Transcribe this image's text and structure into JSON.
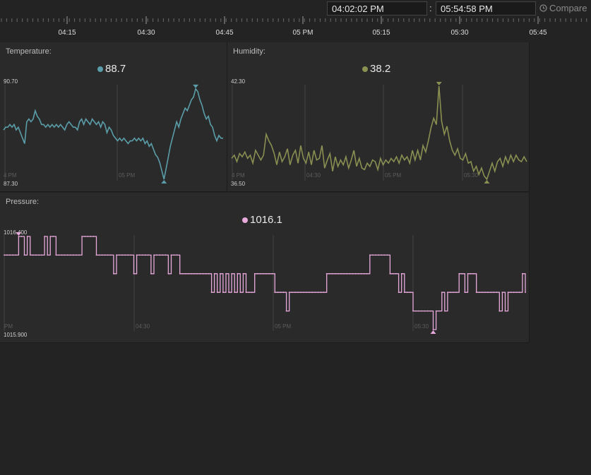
{
  "range": {
    "start": "04:02:02 PM",
    "separator": ":",
    "end": "05:54:58 PM"
  },
  "compare_label": "Compare",
  "timeline_ticks": [
    "04:15",
    "04:30",
    "04:45",
    "05 PM",
    "05:15",
    "05:30",
    "05:45"
  ],
  "colors": {
    "background": "#232323",
    "panel": "#2a2a2a",
    "temperature": "#5a9eaa",
    "humidity": "#8a8f52",
    "pressure": "#e8a9dc"
  },
  "panels": {
    "temperature": {
      "title": "Temperature:",
      "current_value": "88.7",
      "y_max_label": "90.70",
      "y_min_label": "87.30",
      "x_labels": [
        "4 PM",
        "05 PM"
      ],
      "color": "#5a9eaa",
      "ylim": [
        87.3,
        90.7
      ],
      "series": [
        89.1,
        89.2,
        89.2,
        89.3,
        89.2,
        89.3,
        89.1,
        89.2,
        89.0,
        88.8,
        88.6,
        89.4,
        89.5,
        89.4,
        89.5,
        89.8,
        89.6,
        89.5,
        89.3,
        89.3,
        89.2,
        89.3,
        89.2,
        89.3,
        89.2,
        89.3,
        89.2,
        89.3,
        89.2,
        89.1,
        89.3,
        89.4,
        89.3,
        89.2,
        89.2,
        89.1,
        89.4,
        89.5,
        89.3,
        89.5,
        89.4,
        89.3,
        89.5,
        89.4,
        89.3,
        89.4,
        89.2,
        89.4,
        89.3,
        89.0,
        89.2,
        89.1,
        88.9,
        88.8,
        88.7,
        88.8,
        88.7,
        88.8,
        88.7,
        88.6,
        88.7,
        88.7,
        88.8,
        88.7,
        88.8,
        88.7,
        88.8,
        88.6,
        88.7,
        88.5,
        88.6,
        88.4,
        88.2,
        88.1,
        87.9,
        87.6,
        87.3,
        87.7,
        88.1,
        88.5,
        88.8,
        89.1,
        89.4,
        89.2,
        89.5,
        89.7,
        89.9,
        89.8,
        90.0,
        90.2,
        90.3,
        90.6,
        90.5,
        90.2,
        90.0,
        89.7,
        89.5,
        89.6,
        89.3,
        89.2,
        88.9,
        88.7,
        88.9,
        88.8,
        88.8
      ]
    },
    "humidity": {
      "title": "Humidity:",
      "current_value": "38.2",
      "y_max_label": "42.30",
      "y_min_label": "36.50",
      "x_labels": [
        "4 PM",
        "04:30",
        "05 PM",
        "05:30"
      ],
      "color": "#8a8f52",
      "ylim": [
        36.5,
        42.3
      ],
      "series": [
        37.8,
        38.0,
        37.6,
        38.1,
        37.9,
        38.2,
        37.8,
        38.0,
        37.5,
        38.3,
        38.0,
        37.7,
        38.0,
        39.3,
        38.9,
        38.6,
        38.1,
        37.4,
        38.2,
        37.6,
        37.9,
        38.4,
        37.4,
        38.0,
        38.3,
        37.5,
        38.6,
        37.8,
        37.5,
        38.2,
        37.4,
        38.3,
        37.7,
        37.8,
        38.6,
        37.2,
        37.7,
        38.1,
        37.0,
        37.9,
        37.3,
        37.7,
        37.4,
        37.9,
        37.2,
        37.7,
        38.3,
        37.3,
        37.8,
        37.2,
        37.1,
        37.5,
        37.3,
        37.7,
        37.6,
        37.1,
        37.8,
        37.4,
        37.7,
        37.5,
        37.8,
        37.6,
        37.9,
        37.5,
        38.0,
        37.7,
        37.9,
        37.5,
        38.3,
        37.7,
        38.3,
        37.7,
        38.6,
        38.2,
        38.9,
        39.7,
        40.3,
        39.9,
        42.3,
        40.1,
        39.3,
        39.8,
        38.9,
        38.3,
        38.0,
        38.4,
        37.8,
        37.7,
        38.1,
        37.5,
        37.6,
        37.0,
        37.3,
        36.8,
        37.2,
        36.7,
        36.5,
        37.0,
        37.5,
        37.0,
        37.6,
        37.8,
        37.3,
        37.9,
        37.5,
        38.0,
        37.6,
        38.0,
        37.7,
        37.6,
        37.9,
        37.6
      ]
    },
    "pressure": {
      "title": "Pressure:",
      "current_value": "1016.1",
      "y_max_label": "1016.400",
      "y_min_label": "1015.900",
      "x_labels": [
        "PM",
        "04:30",
        "05 PM",
        "05:30"
      ],
      "color": "#e8a9dc",
      "ylim": [
        1015.9,
        1016.4
      ],
      "series": [
        1016.3,
        1016.3,
        1016.3,
        1016.3,
        1016.3,
        1016.4,
        1016.4,
        1016.3,
        1016.4,
        1016.3,
        1016.3,
        1016.3,
        1016.3,
        1016.3,
        1016.4,
        1016.3,
        1016.4,
        1016.4,
        1016.3,
        1016.3,
        1016.3,
        1016.3,
        1016.3,
        1016.3,
        1016.3,
        1016.3,
        1016.3,
        1016.4,
        1016.4,
        1016.4,
        1016.4,
        1016.4,
        1016.3,
        1016.3,
        1016.3,
        1016.3,
        1016.3,
        1016.3,
        1016.2,
        1016.3,
        1016.3,
        1016.3,
        1016.3,
        1016.3,
        1016.3,
        1016.2,
        1016.3,
        1016.3,
        1016.3,
        1016.3,
        1016.3,
        1016.2,
        1016.3,
        1016.3,
        1016.3,
        1016.3,
        1016.3,
        1016.2,
        1016.3,
        1016.3,
        1016.3,
        1016.2,
        1016.2,
        1016.2,
        1016.2,
        1016.2,
        1016.2,
        1016.2,
        1016.2,
        1016.2,
        1016.2,
        1016.2,
        1016.1,
        1016.2,
        1016.1,
        1016.2,
        1016.1,
        1016.2,
        1016.1,
        1016.2,
        1016.1,
        1016.2,
        1016.1,
        1016.2,
        1016.1,
        1016.1,
        1016.1,
        1016.2,
        1016.2,
        1016.2,
        1016.2,
        1016.2,
        1016.2,
        1016.2,
        1016.1,
        1016.1,
        1016.1,
        1016.1,
        1016.0,
        1016.1,
        1016.1,
        1016.1,
        1016.1,
        1016.1,
        1016.1,
        1016.1,
        1016.1,
        1016.1,
        1016.1,
        1016.1,
        1016.1,
        1016.1,
        1016.2,
        1016.2,
        1016.2,
        1016.2,
        1016.2,
        1016.2,
        1016.2,
        1016.2,
        1016.2,
        1016.2,
        1016.2,
        1016.2,
        1016.2,
        1016.2,
        1016.2,
        1016.3,
        1016.3,
        1016.3,
        1016.3,
        1016.3,
        1016.3,
        1016.3,
        1016.2,
        1016.2,
        1016.2,
        1016.1,
        1016.2,
        1016.1,
        1016.1,
        1016.1,
        1016.0,
        1016.0,
        1016.0,
        1016.0,
        1016.0,
        1016.0,
        1016.0,
        1015.9,
        1016.0,
        1016.0,
        1016.1,
        1016.0,
        1016.1,
        1016.1,
        1016.1,
        1016.1,
        1016.2,
        1016.2,
        1016.1,
        1016.2,
        1016.2,
        1016.2,
        1016.1,
        1016.1,
        1016.1,
        1016.1,
        1016.1,
        1016.1,
        1016.1,
        1016.1,
        1016.0,
        1016.1,
        1016.0,
        1016.1,
        1016.1,
        1016.1,
        1016.1,
        1016.1,
        1016.2,
        1016.1
      ]
    }
  }
}
